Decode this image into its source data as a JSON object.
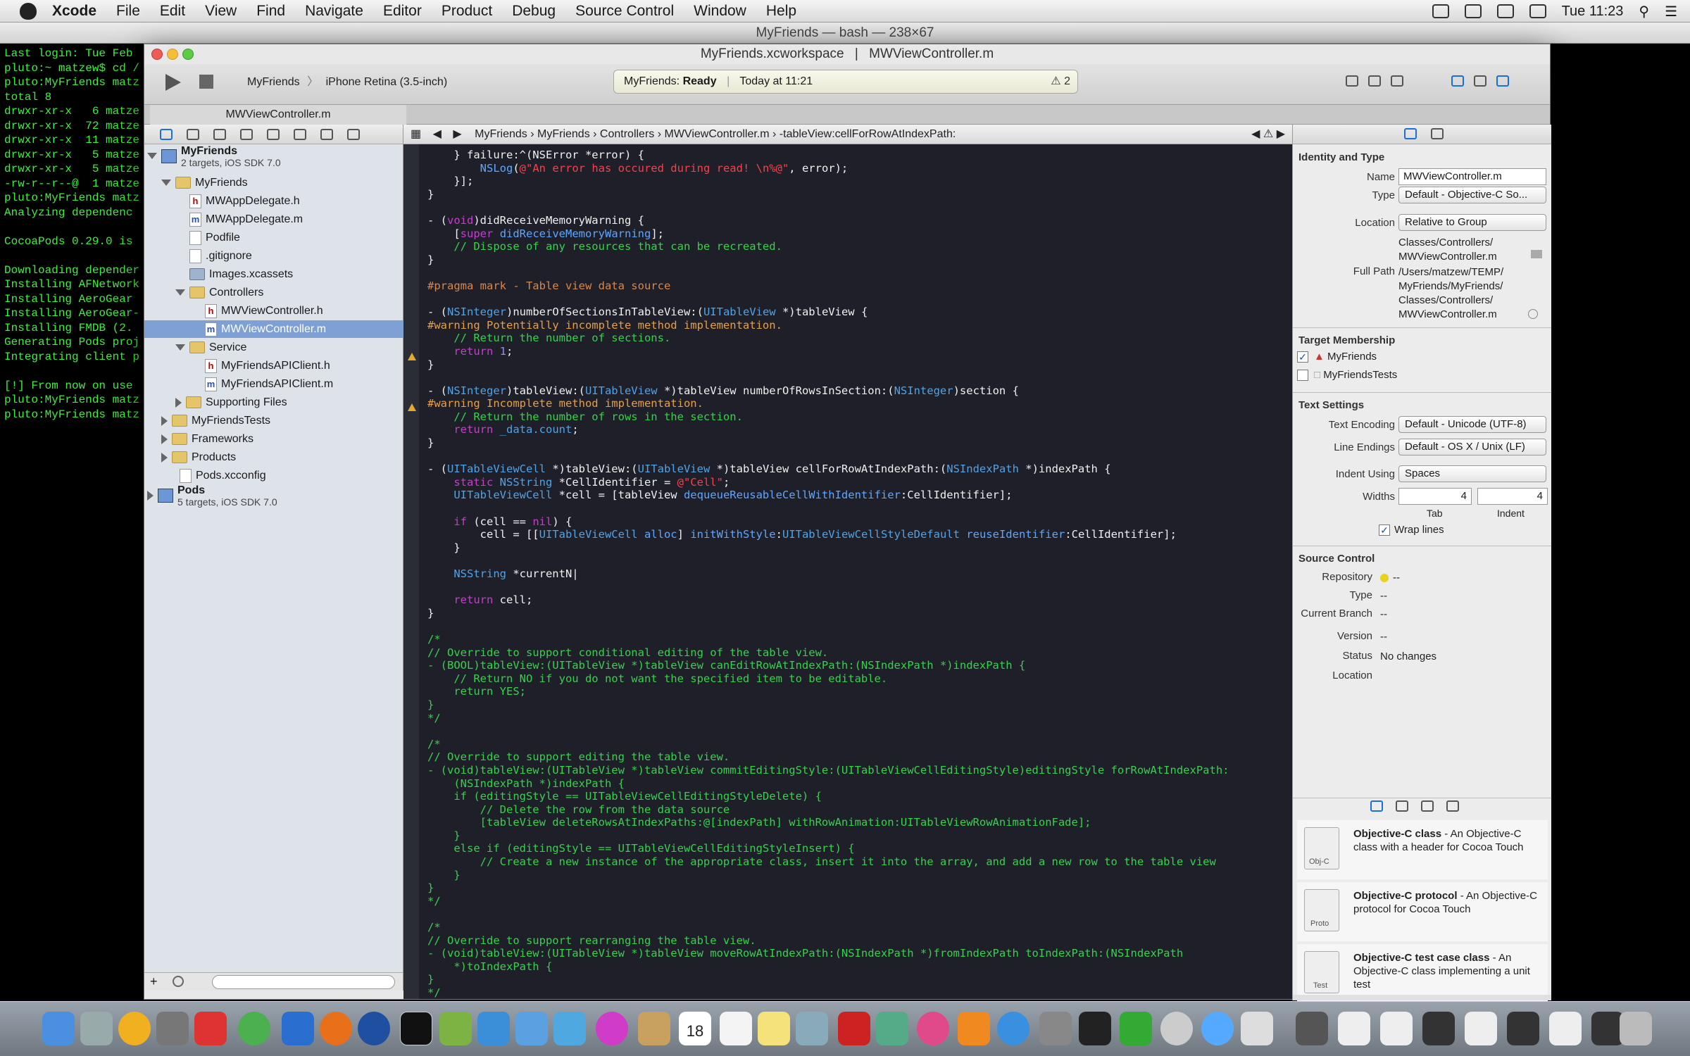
{
  "menubar": {
    "items": [
      "Xcode",
      "File",
      "Edit",
      "View",
      "Find",
      "Navigate",
      "Editor",
      "Product",
      "Debug",
      "Source Control",
      "Window",
      "Help"
    ],
    "clock": "Tue 11:23"
  },
  "terminal": {
    "title": "MyFriends — bash — 238×67",
    "lines": [
      "Last login: Tue Feb",
      "pluto:~ matzew$ cd /",
      "pluto:MyFriends matz",
      "total 8",
      "drwxr-xr-x   6 matze",
      "drwxr-xr-x  72 matze",
      "drwxr-xr-x  11 matze",
      "drwxr-xr-x   5 matze",
      "drwxr-xr-x   5 matze",
      "-rw-r--r--@  1 matze",
      "pluto:MyFriends matz",
      "Analyzing dependenc",
      "",
      "CocoaPods 0.29.0 is",
      "",
      "Downloading depender",
      "Installing AFNetwork",
      "Installing AeroGear",
      "Installing AeroGear-",
      "Installing FMDB (2.",
      "Generating Pods proj",
      "Integrating client p",
      "",
      "[!] From now on use",
      "pluto:MyFriends matz",
      "pluto:MyFriends matz"
    ]
  },
  "xcode": {
    "title": "MyFriends.xcworkspace",
    "title_file": "MWViewController.m",
    "scheme": "MyFriends",
    "device": "iPhone Retina (3.5-inch)",
    "status_project": "MyFriends:",
    "status_state": "Ready",
    "status_time": "Today at 11:21",
    "warning_count": "2",
    "tab": "MWViewController.m",
    "jumpbar": [
      "MyFriends",
      "MyFriends",
      "Controllers",
      "MWViewController.m",
      "-tableView:cellForRowAtIndexPath:"
    ]
  },
  "navigator": {
    "project": "MyFriends",
    "project_sub": "2 targets, iOS SDK 7.0",
    "items": [
      "MyFriends",
      "MWAppDelegate.h",
      "MWAppDelegate.m",
      "Podfile",
      ".gitignore",
      "Images.xcassets",
      "Controllers",
      "MWViewController.h",
      "MWViewController.m",
      "Service",
      "MyFriendsAPIClient.h",
      "MyFriendsAPIClient.m",
      "Supporting Files",
      "MyFriendsTests",
      "Frameworks",
      "Products",
      "Pods.xcconfig"
    ],
    "pods": "Pods",
    "pods_sub": "5 targets, iOS SDK 7.0"
  },
  "inspector": {
    "identity_title": "Identity and Type",
    "name_label": "Name",
    "name": "MWViewController.m",
    "type_label": "Type",
    "type": "Default - Objective-C So...",
    "location_label": "Location",
    "location": "Relative to Group",
    "location_path1": "Classes/Controllers/",
    "location_path2": "MWViewController.m",
    "fullpath_label": "Full Path",
    "fullpath": [
      "/Users/matzew/TEMP/",
      "MyFriends/MyFriends/",
      "Classes/Controllers/",
      "MWViewController.m"
    ],
    "target_title": "Target Membership",
    "targets": [
      "MyFriends",
      "MyFriendsTests"
    ],
    "text_title": "Text Settings",
    "enc_label": "Text Encoding",
    "enc": "Default - Unicode (UTF-8)",
    "le_label": "Line Endings",
    "le": "Default - OS X / Unix (LF)",
    "indent_label": "Indent Using",
    "indent": "Spaces",
    "widths_label": "Widths",
    "tab_width": "4",
    "indent_width": "4",
    "tab_caption": "Tab",
    "indent_caption": "Indent",
    "wrap": "Wrap lines",
    "sc_title": "Source Control",
    "repo_label": "Repository",
    "repo": "--",
    "sctype_label": "Type",
    "sctype": "--",
    "branch_label": "Current Branch",
    "branch": "--",
    "version_label": "Version",
    "version": "--",
    "status_label": "Status",
    "status": "No changes",
    "loc_label": "Location",
    "library": [
      {
        "title": "Objective-C class",
        "desc": " - An Objective-C class with a header for Cocoa Touch",
        "badge": "Obj-C"
      },
      {
        "title": "Objective-C protocol",
        "desc": " - An Objective-C protocol for Cocoa Touch",
        "badge": "Proto"
      },
      {
        "title": "Objective-C test case class",
        "desc": " - An Objective-C class implementing a unit test",
        "badge": "Test"
      }
    ]
  },
  "dock": {
    "calendar_day": "18"
  },
  "colors": {
    "editor_bg": "#1e1f28",
    "keyword": "#c63dd0",
    "type": "#4fa3e8",
    "string": "#f5424a",
    "comment": "#37d14b",
    "terminal_text": "#3df03d"
  }
}
